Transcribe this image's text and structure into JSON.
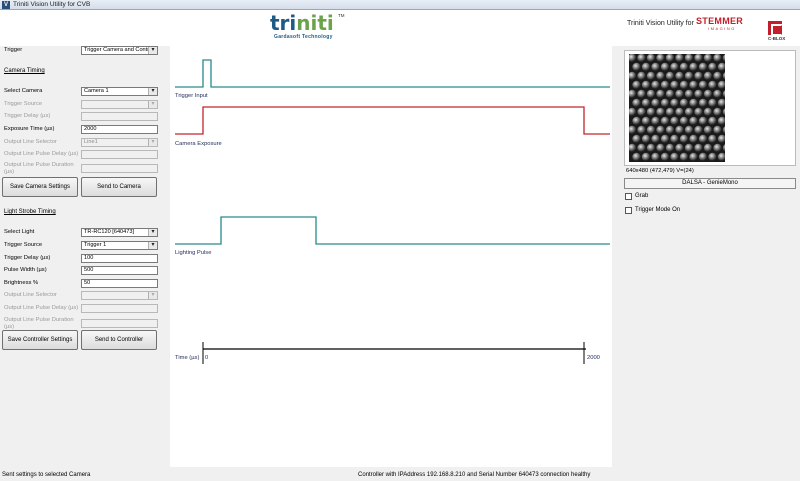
{
  "window": {
    "title": "Triniti Vision Utility for CVB",
    "icon": "app-icon"
  },
  "header": {
    "logo_word_a": "tri",
    "logo_word_b": "niti",
    "logo_tm": "TM",
    "logo_sub": "Gardasoft Technology",
    "right_text": "Triniti Vision Utility for",
    "brand_name": "STEMMER",
    "brand_sub": "IMAGING",
    "brand2": "C-BLOX"
  },
  "controls": {
    "trigger_label": "Trigger",
    "trigger_value": "Trigger Camera and Controlle",
    "camera_section": "Camera Timing",
    "select_camera_label": "Select Camera",
    "select_camera_value": "Camera 1",
    "trigger_source_label": "Trigger Source",
    "trigger_source_value": "",
    "trigger_delay_label": "Trigger Delay (µs)",
    "trigger_delay_value": "",
    "exposure_label": "Exposure Time (µs)",
    "exposure_value": "2000",
    "out_line_sel_label": "Output Line Selector",
    "out_line_sel_value": "Line1",
    "out_pulse_delay_label": "Output Line Pulse Delay  (µs)",
    "out_pulse_delay_value": "",
    "out_pulse_dur_label_1": "Output Line Pulse Duration",
    "out_pulse_dur_label_2": "(µs)",
    "out_pulse_dur_value": "",
    "save_camera_btn": "Save Camera Settings",
    "send_camera_btn": "Send to Camera",
    "light_section": "Light Strobe Timing",
    "select_light_label": "Select Light",
    "select_light_value": "TR-RC120 [640473]",
    "l_trigger_source_label": "Trigger Source",
    "l_trigger_source_value": "Trigger 1",
    "l_trigger_delay_label": "Trigger Delay (µs)",
    "l_trigger_delay_value": "100",
    "pulse_width_label": "Pulse Width (µs)",
    "pulse_width_value": "500",
    "brightness_label": "Brightness %",
    "brightness_value": "50",
    "l_out_line_sel_label": "Output Line Selector",
    "l_out_line_sel_value": "",
    "l_out_pulse_delay_label": "Output Line Pulse Delay (µs)",
    "l_out_pulse_delay_value": "",
    "l_out_pulse_dur_label_1": "Output Line Pulse Duration",
    "l_out_pulse_dur_label_2": "(µs)",
    "l_out_pulse_dur_value": "",
    "save_controller_btn": "Save Controller Settings",
    "send_controller_btn": "Send to Controller"
  },
  "timing": {
    "signals": [
      "Trigger Input",
      "Camera Exposure",
      "Lighting Pulse"
    ],
    "axis_label": "Time (µs)",
    "axis_start": "0",
    "axis_end": "2000",
    "colors": {
      "trigger": "#2a8a8a",
      "exposure": "#c0272d",
      "light": "#2a8a8a",
      "axis": "#000000"
    }
  },
  "right": {
    "coords": "640x480  (472,479)  V=(24)",
    "camera_model": "DALSA - GenieMono",
    "grab_label": "Grab",
    "grab_checked": false,
    "trigger_mode_label": "Trigger Mode On",
    "trigger_mode_checked": false
  },
  "status": {
    "left": "Sent settings to selected Camera",
    "center": "Controller with IPAddress 192.168.8.210 and Serial Number 640473 connection healthy"
  }
}
